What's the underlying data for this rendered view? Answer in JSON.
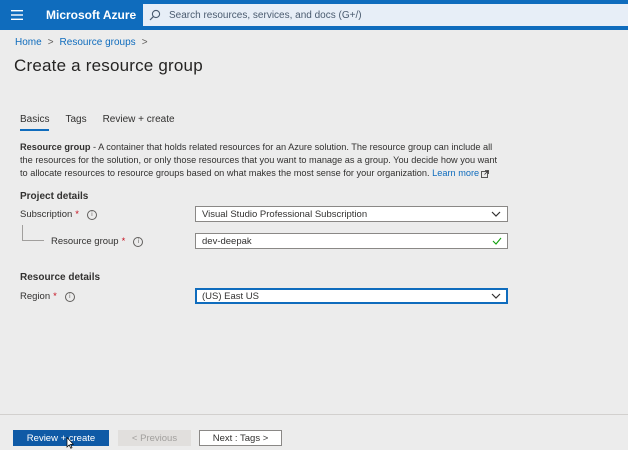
{
  "topbar": {
    "menu_icon": "hamburger-icon",
    "brand": "Microsoft Azure",
    "search_placeholder": "Search resources, services, and docs (G+/)",
    "color": "#0f6cbd"
  },
  "breadcrumb": {
    "items": [
      "Home",
      "Resource groups"
    ],
    "separator": ">"
  },
  "page": {
    "title": "Create a resource group"
  },
  "tabs": [
    {
      "label": "Basics",
      "active": true
    },
    {
      "label": "Tags",
      "active": false
    },
    {
      "label": "Review + create",
      "active": false
    }
  ],
  "description": {
    "bold": "Resource group",
    "text": " - A container that holds related resources for an Azure solution. The resource group can include all the resources for the solution, or only those resources that you want to manage as a group. You decide how you want to allocate resources to resource groups based on what makes the most sense for your organization. ",
    "link": "Learn more"
  },
  "project_details": {
    "heading": "Project details",
    "subscription": {
      "label": "Subscription",
      "required": "*",
      "value": "Visual Studio Professional Subscription"
    },
    "resource_group": {
      "label": "Resource group",
      "required": "*",
      "value": "dev-deepak",
      "valid": true
    }
  },
  "resource_details": {
    "heading": "Resource details",
    "region": {
      "label": "Region",
      "required": "*",
      "value": "(US) East US"
    }
  },
  "footer": {
    "review_create": "Review + create",
    "previous": "< Previous",
    "next": "Next : Tags >"
  },
  "info_icon": "i"
}
